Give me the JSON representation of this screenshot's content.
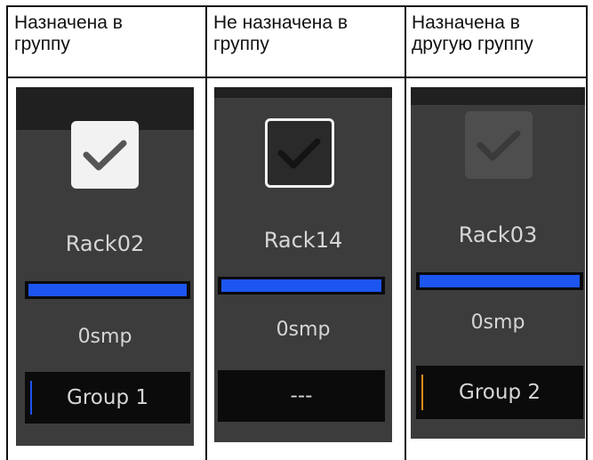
{
  "headers": [
    {
      "line1": "Назначена в",
      "line2": "группу"
    },
    {
      "line1": "Не назначена в",
      "line2": "группу"
    },
    {
      "line1": "Назначена в",
      "line2": "другую группу"
    }
  ],
  "channels": [
    {
      "name": "Rack02",
      "delay": "0smp",
      "group": "Group 1",
      "checkbox_state": "assigned",
      "group_color": "#1d55f0"
    },
    {
      "name": "Rack14",
      "delay": "0smp",
      "group": "---",
      "checkbox_state": "not-assigned",
      "group_color": null
    },
    {
      "name": "Rack03",
      "delay": "0smp",
      "group": "Group 2",
      "checkbox_state": "assigned-other-group",
      "group_color": "#e08a1a"
    }
  ],
  "colors": {
    "meter_fill": "#1d55f0",
    "panel_bg": "#3c3c3c",
    "checked_box": "#f2f2f2",
    "disabled_box": "#4e4e4e"
  },
  "icons": [
    "check-icon"
  ]
}
